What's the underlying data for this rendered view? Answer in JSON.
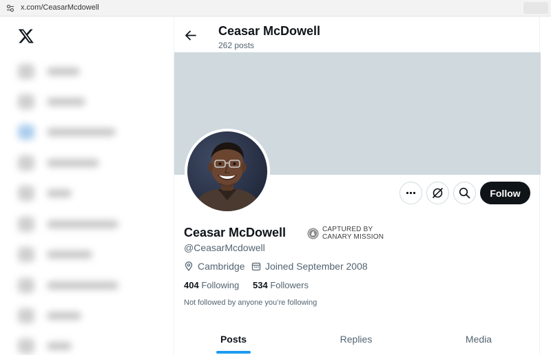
{
  "browser": {
    "url": "x.com/CeasarMcdowell",
    "site_info_icon": "tune-icon"
  },
  "sidebar": {
    "logo_icon": "x-logo-icon",
    "blurred": true
  },
  "header": {
    "back_icon": "arrow-left-icon",
    "name": "Ceasar McDowell",
    "post_count": "262 posts"
  },
  "profile": {
    "banner_color": "#cfd9de",
    "name": "Ceasar McDowell",
    "handle": "@CeasarMcdowell",
    "badge_line1": "CAPTURED BY",
    "badge_line2": "CANARY MISSION",
    "location": "Cambridge",
    "joined": "Joined September 2008",
    "following_count": "404",
    "following_label": "Following",
    "followers_count": "534",
    "followers_label": "Followers",
    "not_followed": "Not followed by anyone you’re following"
  },
  "actions": {
    "more_icon": "more-icon",
    "grok_icon": "grok-icon",
    "search_icon": "search-icon",
    "follow_label": "Follow"
  },
  "tabs": [
    {
      "label": "Posts",
      "active": true
    },
    {
      "label": "Replies",
      "active": false
    },
    {
      "label": "Media",
      "active": false
    }
  ],
  "colors": {
    "accent": "#1d9bf0",
    "follow_bg": "#0f1419",
    "secondary_text": "#536471"
  }
}
